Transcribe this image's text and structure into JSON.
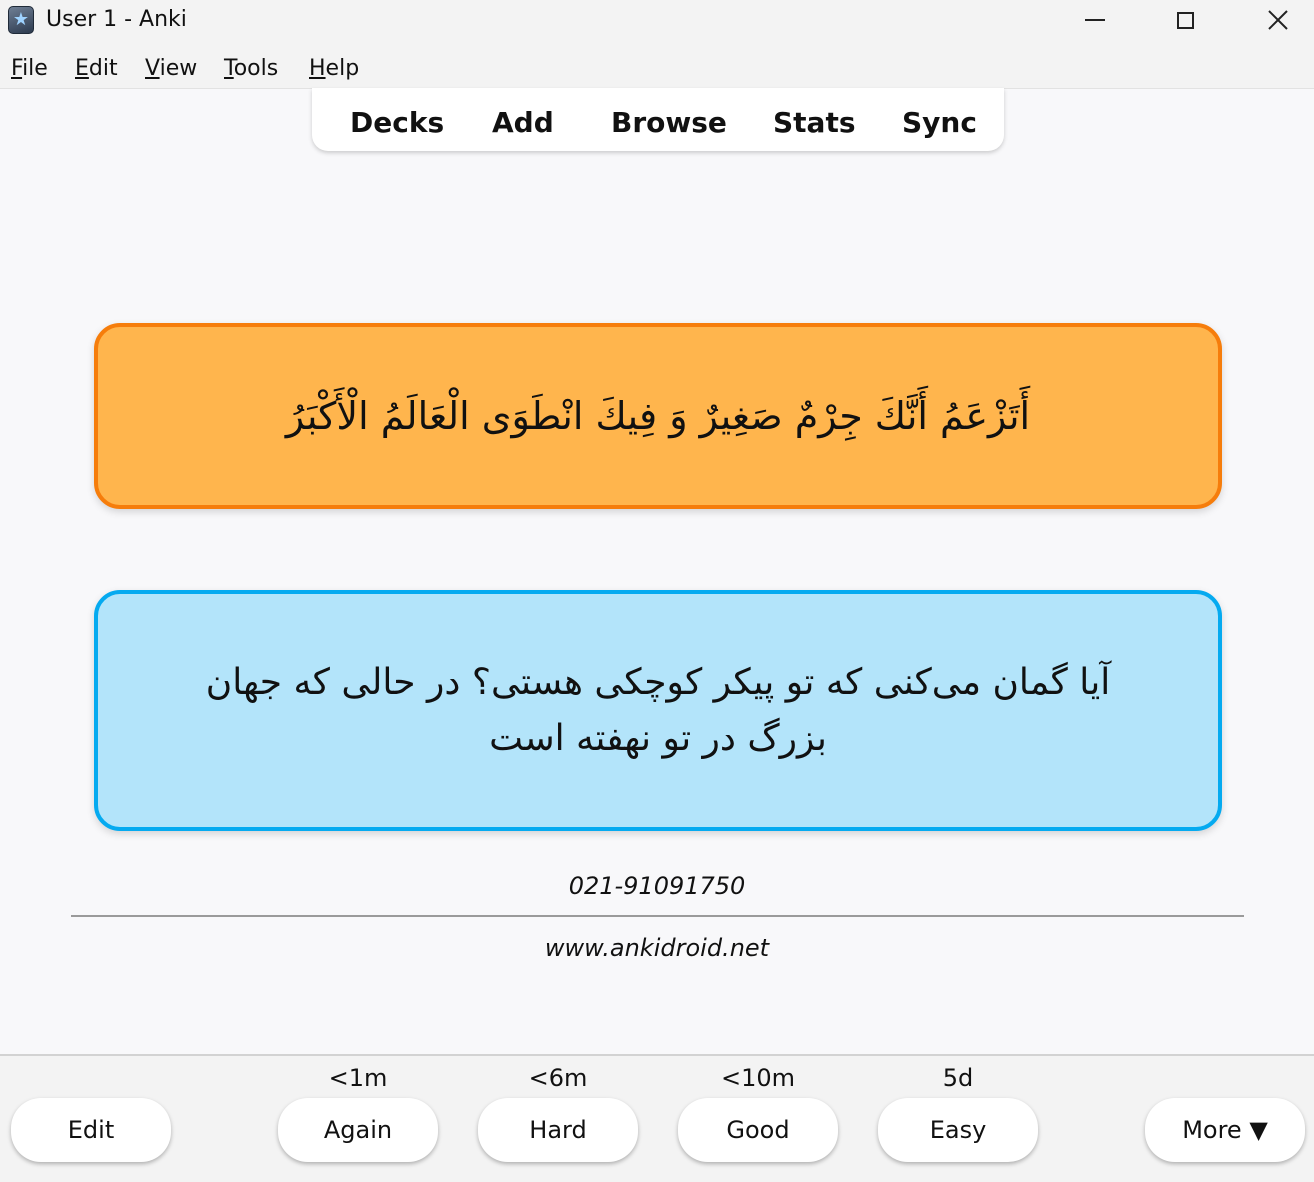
{
  "window": {
    "title": "User 1 - Anki"
  },
  "menu": {
    "items": [
      {
        "key": "F",
        "rest": "ile"
      },
      {
        "key": "E",
        "rest": "dit"
      },
      {
        "key": "V",
        "rest": "iew"
      },
      {
        "key": "T",
        "rest": "ools"
      },
      {
        "key": "H",
        "rest": "elp"
      }
    ]
  },
  "toolbar": {
    "links": [
      "Decks",
      "Add",
      "Browse",
      "Stats",
      "Sync"
    ]
  },
  "card": {
    "front_text": "أَتَزْعَمُ أَنَّكَ جِرْمٌ صَغِيرٌ وَ فِيكَ انْطَوَى الْعَالَمُ الْأَكْبَرُ",
    "back_text": "آیا گمان می‌کنی که تو پیکر کوچکی هستی؟ در حالی که جهان بزرگ در تو نهفته است",
    "phone": "021-91091750",
    "website": "www.ankidroid.net",
    "front_color": "#ffb54d",
    "front_border": "#f67d0b",
    "back_color": "#b3e4fa",
    "back_border": "#05aaf0"
  },
  "bottom": {
    "edit": "Edit",
    "again": {
      "label": "Again",
      "interval": "<1m"
    },
    "hard": {
      "label": "Hard",
      "interval": "<6m"
    },
    "good": {
      "label": "Good",
      "interval": "<10m"
    },
    "easy": {
      "label": "Easy",
      "interval": "5d"
    },
    "more": "More ▼"
  }
}
